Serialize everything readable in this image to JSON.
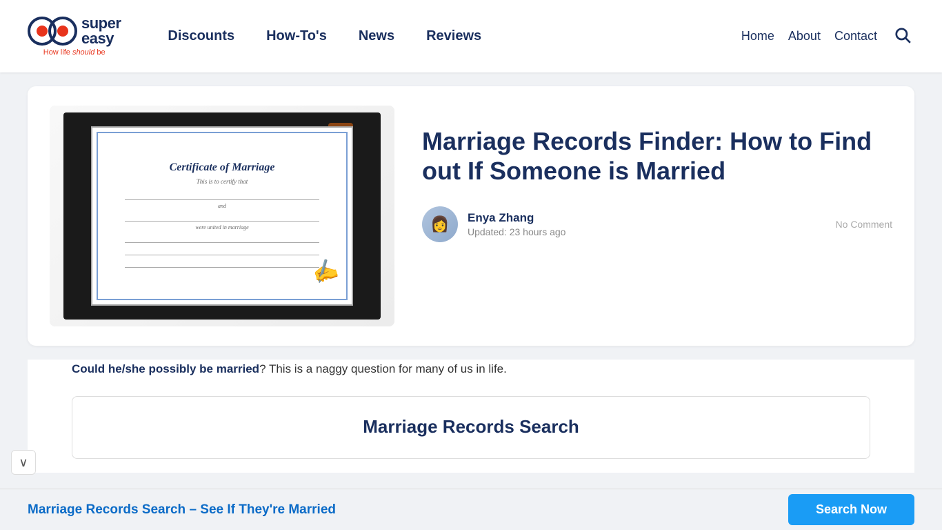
{
  "header": {
    "logo": {
      "super": "super",
      "easy": "easy",
      "tagline_prefix": "How life ",
      "tagline_highlight": "should",
      "tagline_suffix": " be"
    },
    "nav_main": [
      {
        "label": "Discounts",
        "href": "#"
      },
      {
        "label": "How-To's",
        "href": "#"
      },
      {
        "label": "News",
        "href": "#"
      },
      {
        "label": "Reviews",
        "href": "#"
      }
    ],
    "nav_right": [
      {
        "label": "Home",
        "href": "#"
      },
      {
        "label": "About",
        "href": "#"
      },
      {
        "label": "Contact",
        "href": "#"
      }
    ]
  },
  "article": {
    "title": "Marriage Records Finder: How to Find out If Someone is Married",
    "author_name": "Enya Zhang",
    "updated": "Updated: 23 hours ago",
    "no_comment": "No Comment",
    "intro_bold": "Could he/she possibly be married",
    "intro_rest": "? This is a naggy question for many of us in life.",
    "search_widget_title": "Marriage Records Search"
  },
  "bottom_banner": {
    "text": "Marriage Records Search – See If They're Married",
    "button_label": "Search Now"
  },
  "scroll_chevron": "∨"
}
